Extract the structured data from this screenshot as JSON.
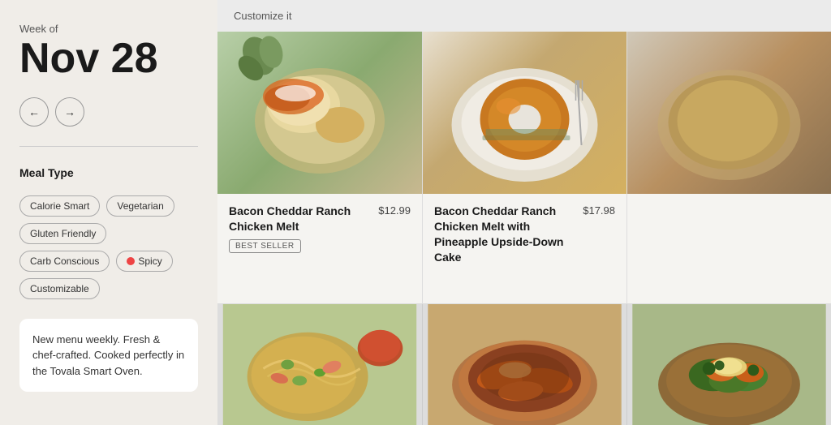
{
  "sidebar": {
    "week_label": "Week of",
    "date": "Nov 28",
    "nav": {
      "prev_label": "←",
      "next_label": "→"
    },
    "meal_type_label": "Meal Type",
    "filters": [
      {
        "id": "calorie-smart",
        "label": "Calorie Smart",
        "icon": null
      },
      {
        "id": "vegetarian",
        "label": "Vegetarian",
        "icon": null
      },
      {
        "id": "gluten-friendly",
        "label": "Gluten Friendly",
        "icon": null
      },
      {
        "id": "carb-conscious",
        "label": "Carb Conscious",
        "icon": null
      },
      {
        "id": "spicy",
        "label": "Spicy",
        "icon": "fire"
      },
      {
        "id": "customizable",
        "label": "Customizable",
        "icon": null
      }
    ],
    "info_text": "New menu weekly. Fresh & chef-crafted. Cooked perfectly in the Tovala Smart Oven."
  },
  "main": {
    "customize_label": "Customize it",
    "meals": [
      {
        "id": "meal-1",
        "title": "Bacon Cheddar Ranch Chicken Melt",
        "price": "$12.99",
        "badge": "BEST SELLER",
        "img_class": "food-img-1"
      },
      {
        "id": "meal-2",
        "title": "Bacon Cheddar Ranch Chicken Melt with Pineapple Upside-Down Cake",
        "price": "$17.98",
        "badge": null,
        "img_class": "food-img-2"
      },
      {
        "id": "meal-3",
        "title": "",
        "price": "",
        "badge": null,
        "img_class": "food-img-3"
      }
    ],
    "bottom_meals": [
      {
        "id": "bottom-1",
        "img_class": "food-img-bottom-1"
      },
      {
        "id": "bottom-2",
        "img_class": "food-img-bottom-2"
      },
      {
        "id": "bottom-3",
        "img_class": "food-img-bottom-3"
      }
    ]
  }
}
